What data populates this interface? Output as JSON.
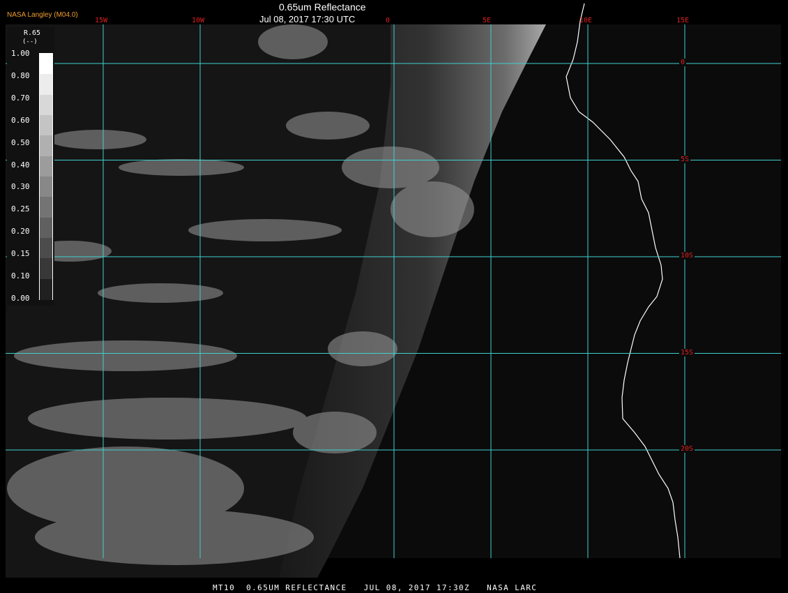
{
  "header": {
    "credit": "NASA Langley (M04.0)",
    "title": "0.65um Reflectance",
    "subtitle": "Jul 08, 2017 17:30 UTC"
  },
  "footer": {
    "text": "MT10  0.65UM REFLECTANCE   JUL 08, 2017 17:30Z   NASA LARC"
  },
  "legend": {
    "title": "R.65",
    "unit": "(--)",
    "ticks": [
      "1.00",
      "0.80",
      "0.70",
      "0.60",
      "0.50",
      "0.40",
      "0.30",
      "0.25",
      "0.20",
      "0.15",
      "0.10",
      "0.00"
    ],
    "colors": [
      "#ffffff",
      "#ececec",
      "#d8d8d8",
      "#c4c4c4",
      "#b0b0b0",
      "#9c9c9c",
      "#888888",
      "#747474",
      "#606060",
      "#4c4c4c",
      "#383838",
      "#202020"
    ]
  },
  "grid": {
    "color": "#40d0d0",
    "label_color": "#e02020",
    "longitudes": [
      {
        "label": "15W",
        "value": -15
      },
      {
        "label": "10W",
        "value": -10
      },
      {
        "label": "0",
        "value": 0
      },
      {
        "label": "5E",
        "value": 5
      },
      {
        "label": "10E",
        "value": 10
      },
      {
        "label": "15E",
        "value": 15
      }
    ],
    "latitudes": [
      {
        "label": "0",
        "value": 0
      },
      {
        "label": "5S",
        "value": -5
      },
      {
        "label": "10S",
        "value": -10
      },
      {
        "label": "15S",
        "value": -15
      },
      {
        "label": "20S",
        "value": -20
      }
    ]
  },
  "colors": {
    "background": "#000000",
    "coastline": "#ffffff",
    "credit": "#f0a030"
  }
}
